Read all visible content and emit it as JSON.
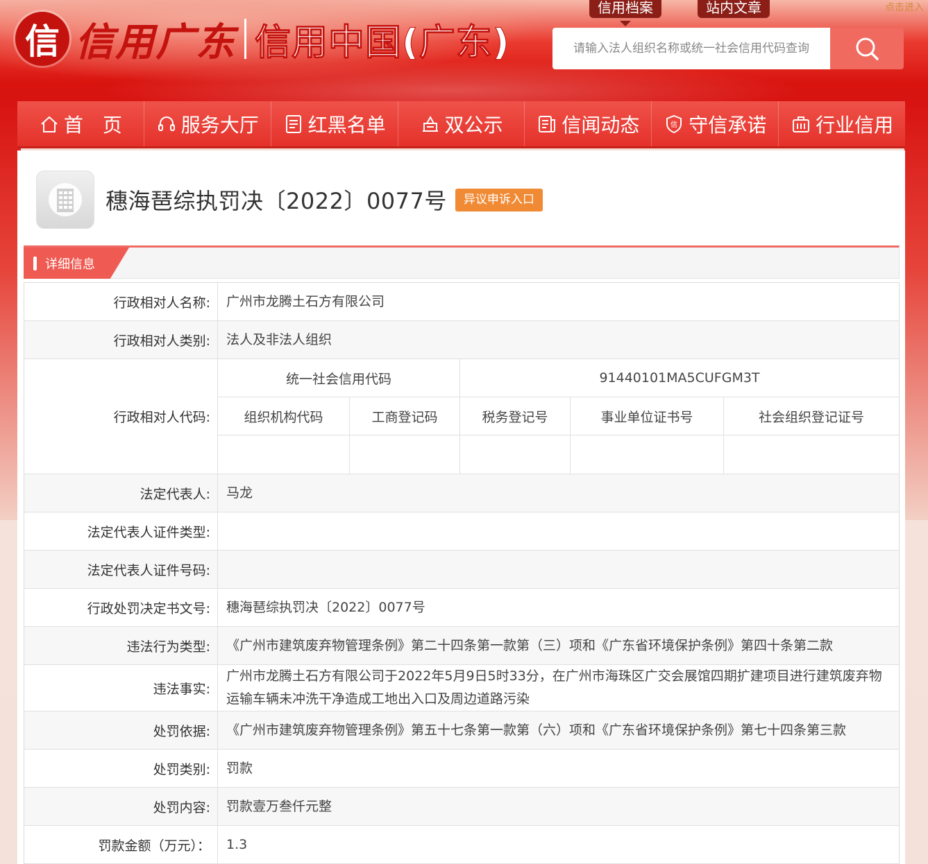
{
  "header": {
    "logo_mark": "信",
    "logo_script": "信用广东",
    "logo_title": "信用中国(广东)",
    "tabs": [
      {
        "label": "信用档案"
      },
      {
        "label": "站内文章"
      }
    ],
    "corner_label": "点击进入",
    "search": {
      "placeholder": "请输入法人组织名称或统一社会信用代码查询"
    }
  },
  "nav": {
    "items": [
      {
        "label": "首　页",
        "icon": "home-icon"
      },
      {
        "label": "服务大厅",
        "icon": "headset-icon"
      },
      {
        "label": "红黑名单",
        "icon": "list-icon"
      },
      {
        "label": "双公示",
        "icon": "announce-icon"
      },
      {
        "label": "信闻动态",
        "icon": "news-icon"
      },
      {
        "label": "守信承诺",
        "icon": "shield-icon"
      },
      {
        "label": "行业信用",
        "icon": "briefcase-icon"
      }
    ]
  },
  "record": {
    "title": "穗海琶综执罚决〔2022〕0077号",
    "appeal_label": "异议申诉入口",
    "section_label": "详细信息"
  },
  "details": {
    "name_label": "行政相对人名称:",
    "name_value": "广州市龙腾土石方有限公司",
    "category_label": "行政相对人类别:",
    "category_value": "法人及非法人组织",
    "code_label": "行政相对人代码:",
    "code_headers": {
      "uscc": "统一社会信用代码",
      "org_code": "组织机构代码",
      "biz_reg": "工商登记码",
      "tax_reg": "税务登记号",
      "inst_cert": "事业单位证书号",
      "social_org": "社会组织登记证号"
    },
    "code_values": {
      "uscc": "91440101MA5CUFGM3T",
      "org_code": "",
      "biz_reg": "",
      "tax_reg": "",
      "inst_cert": "",
      "social_org": ""
    },
    "legal_rep_label": "法定代表人:",
    "legal_rep_value": "马龙",
    "legal_rep_id_type_label": "法定代表人证件类型:",
    "legal_rep_id_type_value": "",
    "legal_rep_id_no_label": "法定代表人证件号码:",
    "legal_rep_id_no_value": "",
    "decision_no_label": "行政处罚决定书文号:",
    "decision_no_value": "穗海琶综执罚决〔2022〕0077号",
    "violation_type_label": "违法行为类型:",
    "violation_type_value": "《广州市建筑废弃物管理条例》第二十四条第一款第（三）项和《广东省环境保护条例》第四十条第二款",
    "facts_label": "违法事实:",
    "facts_value": "广州市龙腾土石方有限公司于2022年5月9日5时33分，在广州市海珠区广交会展馆四期扩建项目进行建筑废弃物运输车辆未冲洗干净造成工地出入口及周边道路污染",
    "basis_label": "处罚依据:",
    "basis_value": "《广州市建筑废弃物管理条例》第五十七条第一款第（六）项和《广东省环境保护条例》第七十四条第三款",
    "penalty_type_label": "处罚类别:",
    "penalty_type_value": "罚款",
    "penalty_content_label": "处罚内容:",
    "penalty_content_value": "罚款壹万叁仟元整",
    "fine_amount_label": "罚款金额（万元）：",
    "fine_amount_value": "1.3"
  }
}
